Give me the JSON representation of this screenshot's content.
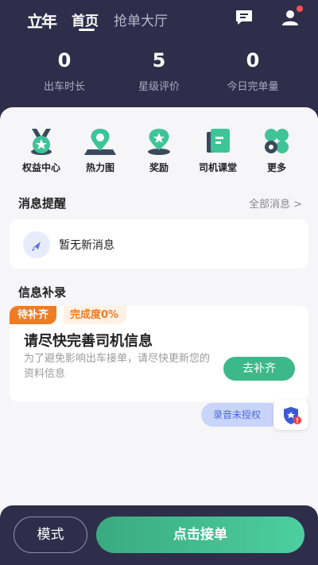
{
  "header": {
    "logo_text": "立年",
    "tabs": [
      {
        "label": "首页",
        "active": true
      },
      {
        "label": "抢单大厅",
        "active": false
      }
    ],
    "icons": [
      "message-icon",
      "user-icon"
    ],
    "notification_dot_color": "#ff4d4f"
  },
  "stats": [
    {
      "value": "0",
      "label": "出车时长"
    },
    {
      "value": "5",
      "label": "星级评价"
    },
    {
      "value": "0",
      "label": "今日完单量"
    }
  ],
  "quick_menu": [
    {
      "label": "权益中心",
      "icon": "badge-star-icon"
    },
    {
      "label": "热力图",
      "icon": "location-pin-icon"
    },
    {
      "label": "奖励",
      "icon": "reward-star-icon"
    },
    {
      "label": "司机课堂",
      "icon": "classroom-book-icon"
    },
    {
      "label": "更多",
      "icon": "more-grid-icon"
    }
  ],
  "messages": {
    "title": "消息提醒",
    "all_link": "全部消息 >",
    "empty_text": "暂无新消息"
  },
  "info_supplement": {
    "title": "信息补录",
    "badge_status": "待补齐",
    "badge_progress": "完成度0%",
    "card_title": "请尽快完善司机信息",
    "card_desc": "为了避免影响出车接单，请尽快更新您的资料信息",
    "button": "去补齐"
  },
  "recording": {
    "label": "录音未授权",
    "icon": "shield-alert-icon"
  },
  "footer": {
    "mode_button": "模式",
    "accept_button": "点击接单"
  },
  "colors": {
    "header_bg": "#2e2e4a",
    "accent_green": "#3db88a",
    "accent_orange": "#f07b21"
  }
}
